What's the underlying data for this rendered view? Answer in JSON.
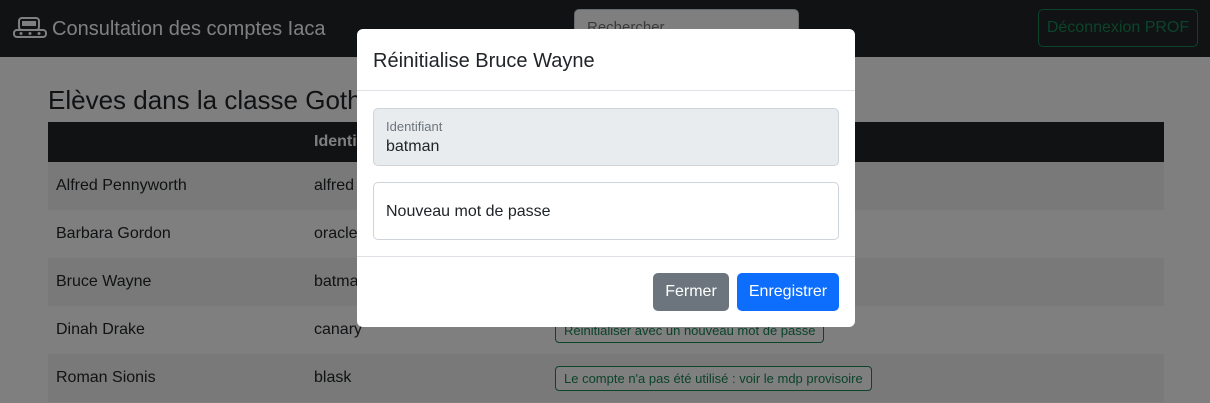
{
  "navbar": {
    "brand_icon": "bus-icon",
    "title": "Consultation des comptes Iaca",
    "search_placeholder": "Rechercher",
    "logout_label": "Déconnexion PROF",
    "logout_color": "#198754"
  },
  "main": {
    "title": "Elèves dans la classe Gotham",
    "table": {
      "headers": [
        "",
        "Identifiant",
        ""
      ],
      "rows": [
        {
          "name": "Alfred Pennyworth",
          "id": "alfred",
          "action": ""
        },
        {
          "name": "Barbara Gordon",
          "id": "oracle",
          "action": ""
        },
        {
          "name": "Bruce Wayne",
          "id": "batman",
          "action": ""
        },
        {
          "name": "Dinah Drake",
          "id": "canary",
          "action": "Réinitialiser avec un nouveau mot de passe"
        },
        {
          "name": "Roman Sionis",
          "id": "blask",
          "action": "Le compte n'a pas été utilisé : voir le mdp provisoire"
        }
      ]
    }
  },
  "modal": {
    "title": "Réinitialise Bruce Wayne",
    "id_field": {
      "label": "Identifiant",
      "value": "batman"
    },
    "password_field": {
      "placeholder": "Nouveau mot de passe"
    },
    "close_label": "Fermer",
    "save_label": "Enregistrer",
    "save_color": "#0d6efd",
    "close_color": "#6c757d"
  }
}
